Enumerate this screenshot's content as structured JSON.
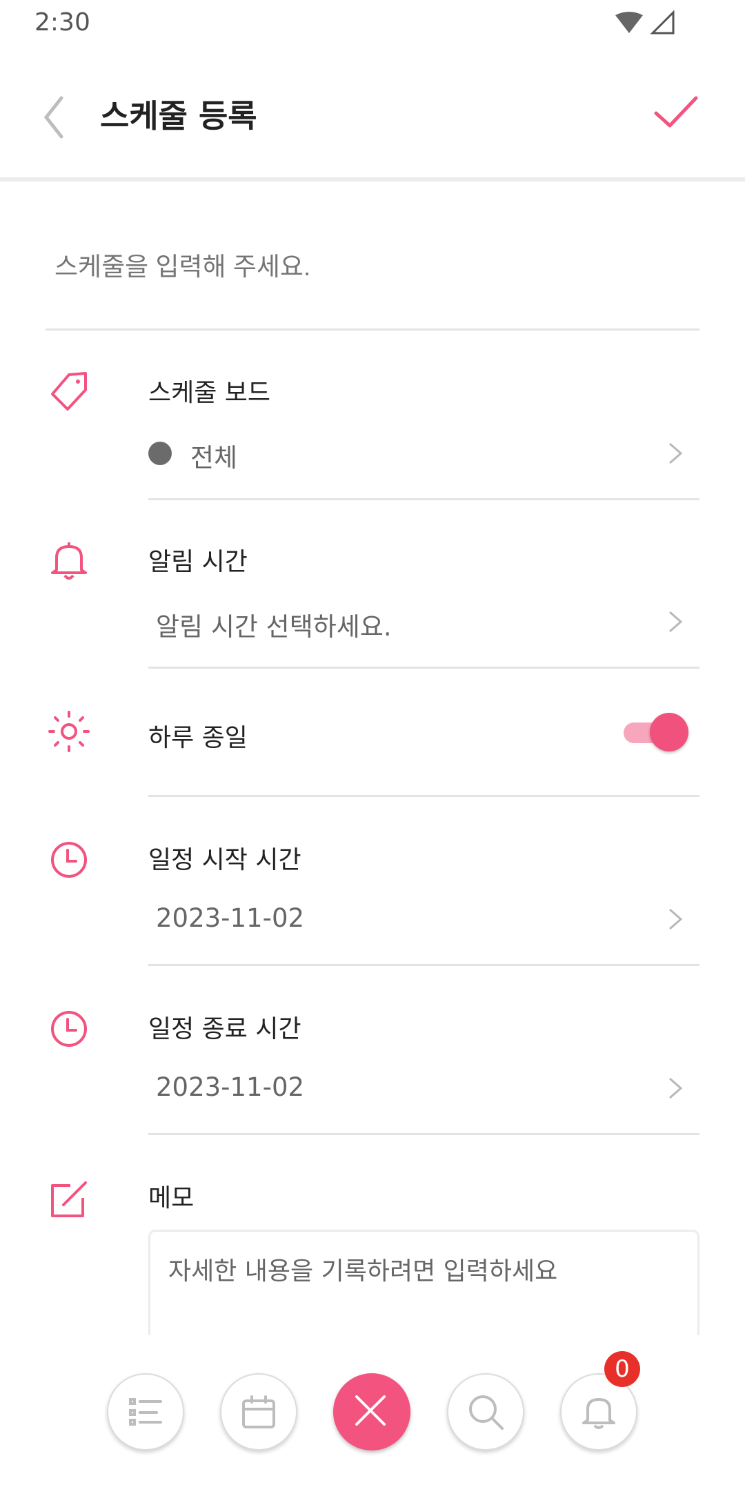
{
  "status_bar": {
    "time": "2:30"
  },
  "header": {
    "title": "스케줄 등록"
  },
  "schedule_input": {
    "placeholder": "스케줄을 입력해 주세요."
  },
  "board": {
    "label": "스케줄 보드",
    "value": "전체"
  },
  "alarm": {
    "label": "알림 시간",
    "value": "알림 시간 선택하세요."
  },
  "all_day": {
    "label": "하루 종일",
    "enabled": true
  },
  "start": {
    "label": "일정 시작 시간",
    "value": "2023-11-02"
  },
  "end": {
    "label": "일정 종료 시간",
    "value": "2023-11-02"
  },
  "memo": {
    "label": "메모",
    "placeholder": "자세한 내용을 기록하려면 입력하세요"
  },
  "bottom_nav": {
    "items": [
      "list-icon",
      "calendar-icon",
      "close-icon",
      "search-icon",
      "bell-icon"
    ],
    "notification_count": "0"
  },
  "colors": {
    "accent": "#f2537f",
    "badge": "#e8302a"
  }
}
